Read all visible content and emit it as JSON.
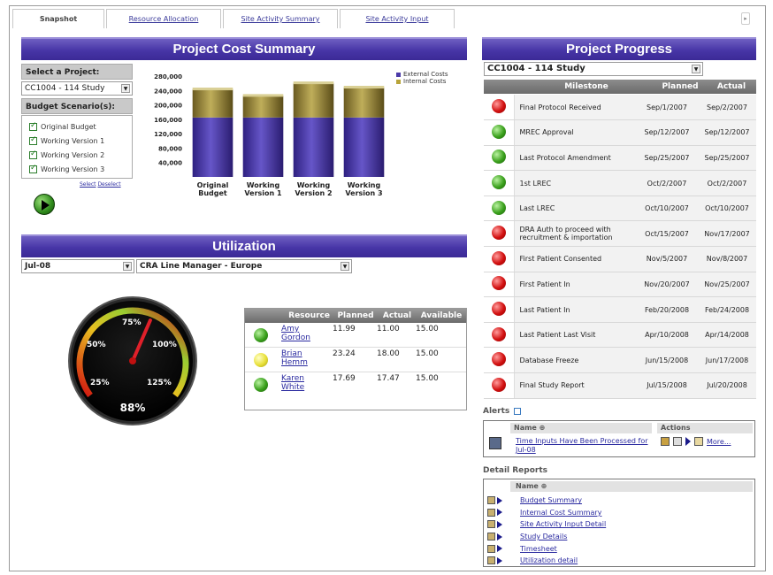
{
  "tabs": [
    {
      "label": "Snapshot",
      "active": true
    },
    {
      "label": "Resource Allocation",
      "active": false
    },
    {
      "label": "Site Activity Summary",
      "active": false
    },
    {
      "label": "Site Activity Input",
      "active": false
    }
  ],
  "cost": {
    "title": "Project Cost Summary",
    "select_project_label": "Select a Project:",
    "project": "CC1004 - 114 Study",
    "budget_label": "Budget Scenario(s):",
    "scenarios": [
      "Original Budget",
      "Working Version 1",
      "Working Version 2",
      "Working Version 3"
    ],
    "select_all": "Select",
    "deselect": "Deselect",
    "legend": [
      "External Costs",
      "Internal Costs"
    ]
  },
  "chart_data": {
    "type": "bar",
    "stacked": true,
    "categories": [
      "Original Budget",
      "Working Version 1",
      "Working Version 2",
      "Working Version 3"
    ],
    "category_lines": [
      [
        "Original",
        "Budget"
      ],
      [
        "Working",
        "Version 1"
      ],
      [
        "Working",
        "Version 2"
      ],
      [
        "Working",
        "Version 3"
      ]
    ],
    "series": [
      {
        "name": "External Costs",
        "values": [
          165000,
          165000,
          165000,
          165000
        ],
        "color": "#4b3aa8"
      },
      {
        "name": "Internal Costs",
        "values": [
          78000,
          60000,
          95000,
          83000
        ],
        "color": "#8f7f30"
      }
    ],
    "yticks": [
      "280,000",
      "240,000",
      "200,000",
      "160,000",
      "120,000",
      "80,000",
      "40,000"
    ],
    "ylim": [
      0,
      280000
    ]
  },
  "progress": {
    "title": "Project Progress",
    "project": "CC1004 - 114 Study",
    "headers": {
      "milestone": "Milestone",
      "planned": "Planned",
      "actual": "Actual"
    },
    "rows": [
      {
        "status": "red",
        "name": "Final Protocol Received",
        "planned": "Sep/1/2007",
        "actual": "Sep/2/2007"
      },
      {
        "status": "green",
        "name": "MREC Approval",
        "planned": "Sep/12/2007",
        "actual": "Sep/12/2007"
      },
      {
        "status": "green",
        "name": "Last Protocol Amendment",
        "planned": "Sep/25/2007",
        "actual": "Sep/25/2007"
      },
      {
        "status": "green",
        "name": "1st LREC",
        "planned": "Oct/2/2007",
        "actual": "Oct/2/2007"
      },
      {
        "status": "green",
        "name": "Last LREC",
        "planned": "Oct/10/2007",
        "actual": "Oct/10/2007"
      },
      {
        "status": "red",
        "name": "DRA Auth to proceed with recruitment & importation",
        "planned": "Oct/15/2007",
        "actual": "Nov/17/2007"
      },
      {
        "status": "red",
        "name": "First Patient Consented",
        "planned": "Nov/5/2007",
        "actual": "Nov/8/2007"
      },
      {
        "status": "red",
        "name": "First Patient In",
        "planned": "Nov/20/2007",
        "actual": "Nov/25/2007"
      },
      {
        "status": "red",
        "name": "Last Patient In",
        "planned": "Feb/20/2008",
        "actual": "Feb/24/2008"
      },
      {
        "status": "red",
        "name": "Last Patient Last Visit",
        "planned": "Apr/10/2008",
        "actual": "Apr/14/2008"
      },
      {
        "status": "red",
        "name": "Database Freeze",
        "planned": "Jun/15/2008",
        "actual": "Jun/17/2008"
      },
      {
        "status": "red",
        "name": "Final Study Report",
        "planned": "Jul/15/2008",
        "actual": "Jul/20/2008"
      }
    ]
  },
  "utilization": {
    "title": "Utilization",
    "period": "Jul-08",
    "manager": "CRA Line Manager - Europe",
    "gauge": {
      "labels": [
        "25%",
        "50%",
        "75%",
        "100%",
        "125%"
      ],
      "value_label": "88%",
      "value_percent": 88
    },
    "headers": {
      "resource": "Resource",
      "planned": "Planned",
      "actual": "Actual",
      "available": "Available"
    },
    "rows": [
      {
        "status": "green",
        "first": "Amy",
        "last": "Gordon",
        "planned": "11.99",
        "actual": "11.00",
        "available": "15.00"
      },
      {
        "status": "yellow",
        "first": "Brian",
        "last": "Hemm",
        "planned": "23.24",
        "actual": "18.00",
        "available": "15.00"
      },
      {
        "status": "green",
        "first": "Karen",
        "last": "White",
        "planned": "17.69",
        "actual": "17.47",
        "available": "15.00"
      }
    ]
  },
  "alerts": {
    "title": "Alerts",
    "name_header": "Name",
    "actions_header": "Actions",
    "items": [
      {
        "name": "Time Inputs Have Been Processed for Jul-08",
        "more": "More..."
      }
    ]
  },
  "reports": {
    "title": "Detail Reports",
    "name_header": "Name",
    "items": [
      "Budget Summary",
      "Internal Cost Summary",
      "Site Activity Input Detail",
      "Study Details",
      "Timesheet",
      "Utilization detail"
    ]
  }
}
